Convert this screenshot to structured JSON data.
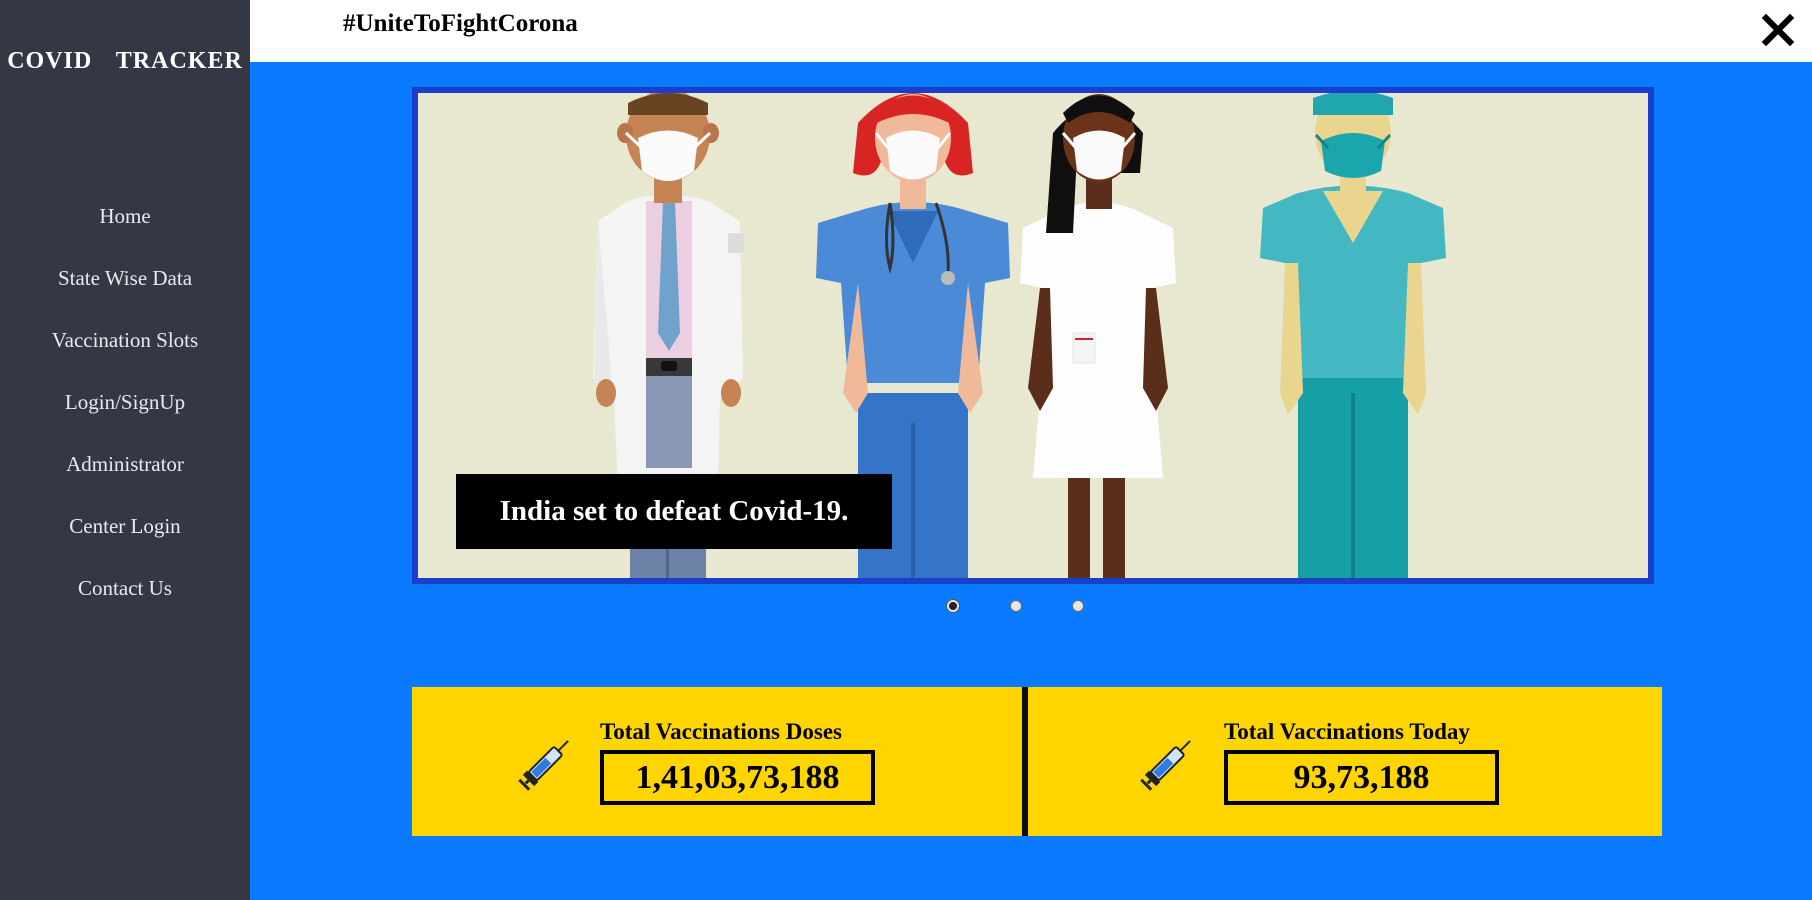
{
  "sidebar": {
    "brand": "COVID  TRACKER",
    "items": [
      {
        "label": "Home"
      },
      {
        "label": "State Wise Data"
      },
      {
        "label": "Vaccination Slots"
      },
      {
        "label": "Login/SignUp"
      },
      {
        "label": "Administrator"
      },
      {
        "label": "Center Login"
      },
      {
        "label": "Contact Us"
      }
    ]
  },
  "header": {
    "hashtag": "#UniteToFightCorona",
    "close_icon": "close-icon"
  },
  "carousel": {
    "caption": "India set to defeat Covid-19.",
    "slide_count": 3,
    "active_slide": 0
  },
  "stats": {
    "total_doses": {
      "label": "Total Vaccinations Doses",
      "value": "1,41,03,73,188",
      "icon": "syringe-icon"
    },
    "today": {
      "label": "Total Vaccinations Today",
      "value": "93,73,188",
      "icon": "syringe-icon"
    }
  },
  "colors": {
    "sidebar_bg": "#343845",
    "page_bg": "#0a7bff",
    "carousel_border": "#1a3fc9",
    "stats_bg": "#ffd500"
  }
}
